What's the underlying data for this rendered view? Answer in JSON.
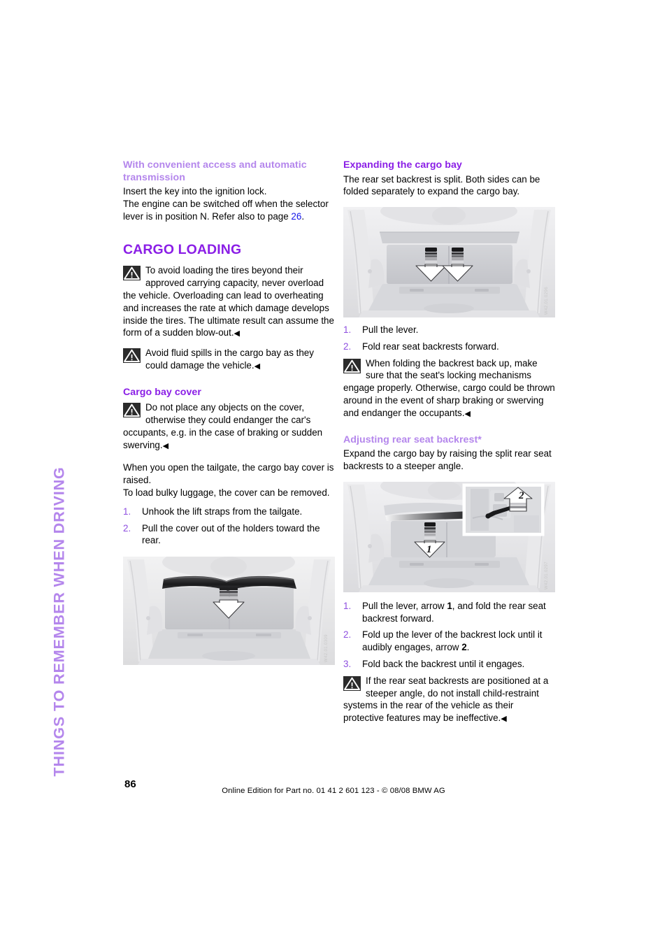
{
  "page": {
    "running_head": "THINGS TO REMEMBER WHEN DRIVING",
    "folio": "86",
    "footer_line": "Online Edition for Part no. 01 41 2 601 123  - © 08/08 BMW AG",
    "colors": {
      "heading_dark_purple": "#8a1ee6",
      "heading_light_purple": "#b486ec",
      "list_number_purple": "#8e4fe0",
      "crossref_blue": "#1516e8",
      "warning_icon_bg": "#2b2b2b",
      "figure_bg": "#ececed",
      "body_text": "#000000"
    }
  },
  "left_column": {
    "subhead_convenient_access": "With convenient access and automatic transmission",
    "para_insert_key": "Insert the key into the ignition lock.",
    "para_engine_off_pre": "The engine can be switched off when the selector lever is in position N. Refer also to page ",
    "para_engine_off_page_ref": "26",
    "para_engine_off_post": ".",
    "section_title": "CARGO LOADING",
    "warning_overload": "To avoid loading the tires beyond their approved carrying capacity, never overload the vehicle. Overloading can lead to overheating and increases the rate at which damage develops inside the tires. The ultimate result can assume the form of a sudden blow-out.",
    "warning_fluid_spills": "Avoid fluid spills in the cargo bay as they could damage the vehicle.",
    "subhead_cargo_bay_cover": "Cargo bay cover",
    "warning_no_objects": "Do not place any objects on the cover, otherwise they could endanger the car's occupants, e.g. in the case of braking or sudden swerving.",
    "para_tailgate_raise": "When you open the tailgate, the cargo bay cover is raised.",
    "para_bulky_luggage": "To load bulky luggage, the cover can be removed.",
    "steps_cover_removal": [
      {
        "num": "1.",
        "text": "Unhook the lift straps from the tailgate."
      },
      {
        "num": "2.",
        "text": "Pull the cover out of the holders toward the rear."
      }
    ],
    "figure_cargo_cover": {
      "alt": "Rear cargo bay of vehicle with cargo bay cover and downward arrow",
      "watermark": "W42.01.0309"
    }
  },
  "right_column": {
    "subhead_expanding_cargo_bay": "Expanding the cargo bay",
    "para_split_backrest": "The rear set backrest is split. Both sides can be folded separately to expand the cargo bay.",
    "figure_expanding": {
      "alt": "Cargo bay with two downward arrows pointing at rear seat backrest levers",
      "watermark": "W42.01.0296"
    },
    "steps_expanding": [
      {
        "num": "1.",
        "text": "Pull the lever."
      },
      {
        "num": "2.",
        "text": "Fold rear seat backrests forward."
      }
    ],
    "warning_locking": "When folding the backrest back up, make sure that the seat's locking mechanisms engage properly. Otherwise, cargo could be thrown around in the event of sharp braking or swerving and endanger the occupants.",
    "subhead_adjusting_backrest": "Adjusting rear seat backrest*",
    "para_raise_steeper": "Expand the cargo bay by raising the split rear seat backrests to a steeper angle.",
    "figure_adjusting": {
      "alt": "Cargo bay with arrow 1 at lever and inset detail with arrow 2 at backrest lock",
      "watermark": "W42.01.0297",
      "callout_1": "1",
      "callout_2": "2"
    },
    "steps_adjusting": [
      {
        "num": "1.",
        "pre": "Pull the lever, arrow ",
        "bold": "1",
        "post": ", and fold the rear seat backrest forward."
      },
      {
        "num": "2.",
        "pre": "Fold up the lever of the backrest lock until it audibly engages, arrow ",
        "bold": "2",
        "post": "."
      },
      {
        "num": "3.",
        "pre": "Fold back the backrest until it engages.",
        "bold": "",
        "post": ""
      }
    ],
    "warning_child_restraint": "If the rear seat backrests are positioned at a steeper angle, do not install child-restraint systems in the rear of the vehicle as their protective features may be ineffective."
  }
}
